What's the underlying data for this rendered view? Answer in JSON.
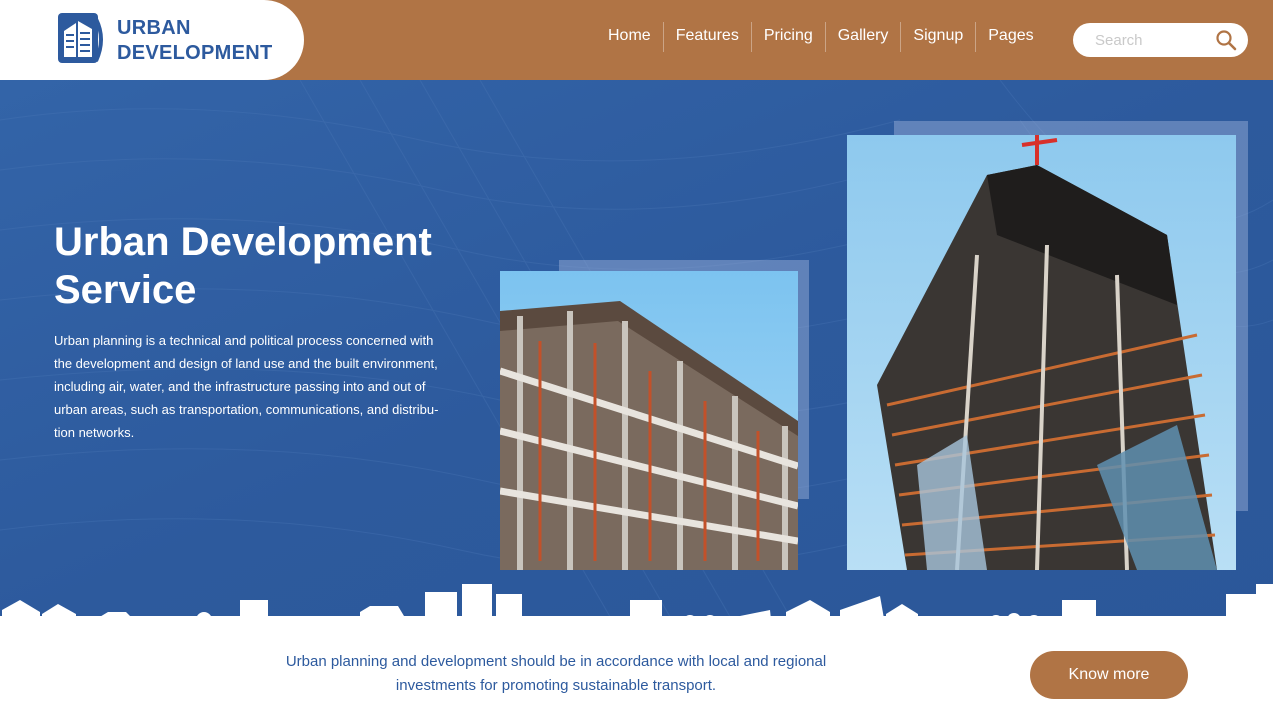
{
  "brand": {
    "line1": "URBAN",
    "line2": "DEVELOPMENT",
    "icon": "building-logo-icon",
    "color": "#2d5a9e"
  },
  "nav": {
    "items": [
      {
        "label": "Home"
      },
      {
        "label": "Features"
      },
      {
        "label": "Pricing"
      },
      {
        "label": "Gallery"
      },
      {
        "label": "Signup"
      },
      {
        "label": "Pages"
      }
    ]
  },
  "search": {
    "placeholder": "Search",
    "value": "",
    "icon": "search-icon"
  },
  "hero": {
    "title": "Urban Development Service",
    "description": "Urban planning is a technical and political process concerned with the development and design of land use and the built environment, including air, water, and the infrastructure passing into and out of urban areas, such as transportation, communications, and distribu-tion networks.",
    "background_color": "#2e5b9f",
    "images": [
      {
        "name": "construction-building-photo"
      },
      {
        "name": "skyscraper-construction-photo"
      }
    ]
  },
  "band": {
    "text": "Urban planning and development should be in accordance with local and regional investments for promoting sustainable transport.",
    "button_label": "Know more"
  },
  "colors": {
    "accent": "#b07445",
    "primary": "#2d5a9e"
  }
}
